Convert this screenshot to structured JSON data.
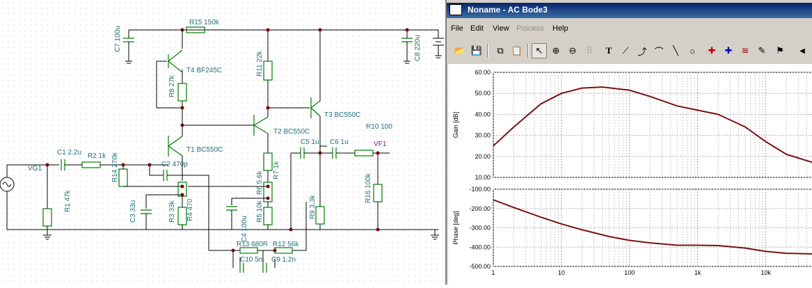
{
  "schematic": {
    "labels": {
      "vg1": "VG1",
      "r1": "R1 47k",
      "c1": "C1 2.2u",
      "r2": "R2 1k",
      "r14": "R14 270k",
      "c2": "C2 470p",
      "c3": "C3 33u",
      "r3": "R3 33k",
      "r4": "R4 470",
      "t1": "T1 BC550C",
      "t2": "T2 BC550C",
      "t3": "T3 BC550C",
      "t4": "T4 BF245C",
      "r8": "R8 27k",
      "r11": "R11 22k",
      "r15": "R15 150k",
      "c7": "C7 100u",
      "c8": "C8 220u",
      "r6": "R6 5.6k",
      "r7": "R7 1k",
      "r5": "R5 10k",
      "c4": "C4 100u",
      "r9": "R9 3.3k",
      "c5": "C5 1u",
      "c6": "C6 1u",
      "r10": "R10 100",
      "r16": "R16 100k",
      "vf1": "VF1",
      "r13": "R13 680R",
      "r12": "R12 56k",
      "c10": "C10 5n",
      "c9": "C9 1.2n"
    }
  },
  "window": {
    "title": "Noname - AC Bode3",
    "menu": [
      "File",
      "Edit",
      "View",
      "Process",
      "Help"
    ],
    "menu_disabled": [
      "Process"
    ],
    "toolbar_icons": [
      "open-folder-icon",
      "save-icon",
      "copy-icon",
      "paste-icon",
      "pointer-icon",
      "zoom-in-icon",
      "zoom-out-icon",
      "grid-icon",
      "text-icon",
      "line-tool-icon",
      "curve-tool-icon",
      "arc-tool-icon",
      "straight-line-icon",
      "circle-icon",
      "marker-a-icon",
      "marker-b-icon",
      "wave-icon",
      "probe-icon",
      "flag-icon",
      "scroll-left-icon"
    ]
  },
  "chart_data": [
    {
      "type": "line",
      "ylabel": "Gain [dB]",
      "xscale": "log",
      "xlim": [
        1,
        50000
      ],
      "ylim": [
        10,
        60
      ],
      "yticks": [
        "60.00",
        "50.00",
        "40.00",
        "30.00",
        "20.00",
        "10.00"
      ],
      "grid": true,
      "series": [
        {
          "color": "#7a1010",
          "x": [
            1,
            2,
            5,
            10,
            20,
            40,
            100,
            200,
            500,
            1000,
            2000,
            5000,
            10000,
            20000,
            50000
          ],
          "values": [
            25,
            34,
            45,
            50,
            52.5,
            53,
            51.5,
            48.5,
            44,
            42,
            40,
            34,
            27,
            21,
            17
          ]
        }
      ]
    },
    {
      "type": "line",
      "ylabel": "Phase [deg]",
      "xscale": "log",
      "xlim": [
        1,
        50000
      ],
      "ylim": [
        -500,
        -100
      ],
      "yticks": [
        "-100.00",
        "-200.00",
        "-300.00",
        "-400.00",
        "-500.00"
      ],
      "xticks": [
        "1",
        "10",
        "100",
        "1k",
        "10k"
      ],
      "grid": true,
      "series": [
        {
          "color": "#7a1010",
          "x": [
            1,
            2,
            5,
            10,
            20,
            50,
            100,
            200,
            500,
            1000,
            2000,
            5000,
            10000,
            20000,
            50000
          ],
          "values": [
            -155,
            -195,
            -245,
            -280,
            -310,
            -345,
            -365,
            -378,
            -390,
            -390,
            -392,
            -405,
            -422,
            -432,
            -435
          ]
        }
      ]
    }
  ]
}
